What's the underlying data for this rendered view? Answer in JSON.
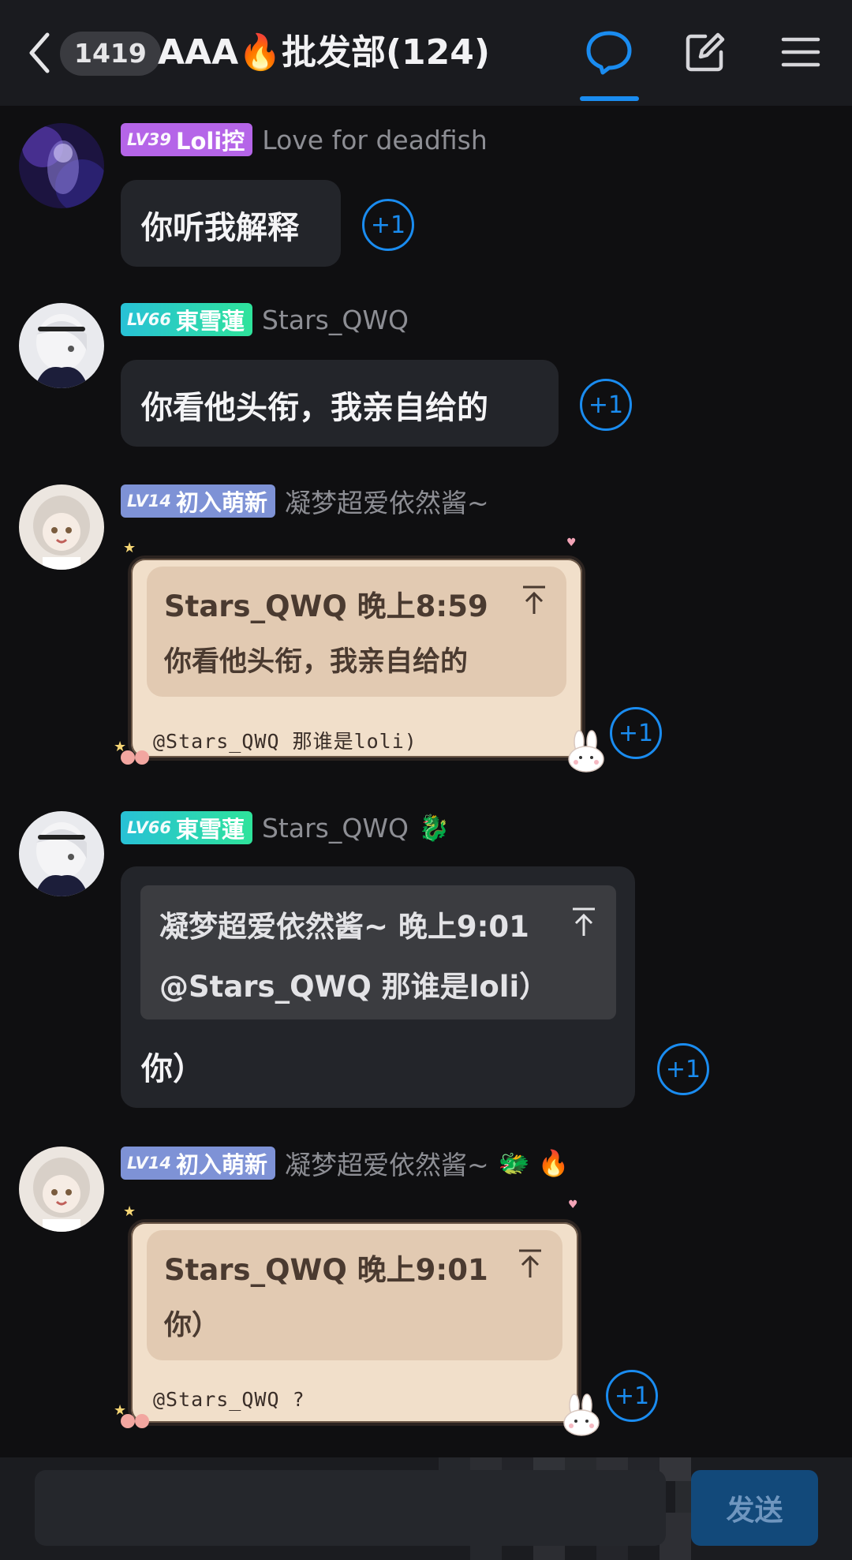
{
  "header": {
    "unread_count": "1419",
    "title": "AAA🔥批发部(124)",
    "back_icon": "chevron-left-icon",
    "chat_icon": "chat-bubble-icon",
    "edit_icon": "edit-icon",
    "menu_icon": "hamburger-menu-icon",
    "accent": "#1a8cf0"
  },
  "messages": [
    {
      "tag_level": "LV39",
      "tag_title": "Loli控",
      "tag_color": "#b565e8",
      "username": "Love for deadfish",
      "text": "你听我解释",
      "plus_one": "+1"
    },
    {
      "tag_level": "LV66",
      "tag_title": "東雪蓮",
      "tag_color": "#26c9b6",
      "username": "Stars_QWQ",
      "text": "你看他头衔，我亲自给的",
      "plus_one": "+1"
    },
    {
      "tag_level": "LV14",
      "tag_title": "初入萌新",
      "tag_color": "#7e92d6",
      "username": "凝梦超爱依然酱~",
      "quote_header": "Stars_QWQ 晚上8:59",
      "quote_text": "你看他头衔，我亲自给的",
      "text": "@Stars_QWQ 那谁是loli)",
      "plus_one": "+1"
    },
    {
      "tag_level": "LV66",
      "tag_title": "東雪蓮",
      "tag_color": "#26c9b6",
      "username": "Stars_QWQ",
      "name_emoji": "🐉",
      "quote_header": "凝梦超爱依然酱~ 晚上9:01",
      "quote_text": "@Stars_QWQ 那谁是loli）",
      "text": "你）",
      "plus_one": "+1"
    },
    {
      "tag_level": "LV14",
      "tag_title": "初入萌新",
      "tag_color": "#7e92d6",
      "username": "凝梦超爱依然酱~",
      "name_emoji": "🐲 🔥",
      "quote_header": "Stars_QWQ 晚上9:01",
      "quote_text": "你）",
      "text": "@Stars_QWQ  ?",
      "plus_one": "+1"
    }
  ],
  "composer": {
    "placeholder": "",
    "send_label": "发送"
  }
}
